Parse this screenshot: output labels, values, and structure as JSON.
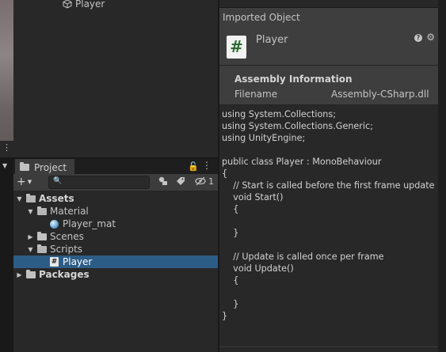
{
  "hierarchy": {
    "items": [
      {
        "label": "Player",
        "icon": "cube-icon"
      }
    ]
  },
  "project": {
    "tab_label": "Project",
    "toolbar": {
      "search_value": "",
      "hidden_count": "1"
    },
    "tree": {
      "assets": "Assets",
      "material": "Material",
      "player_mat": "Player_mat",
      "scenes": "Scenes",
      "scripts": "Scripts",
      "player_script": "Player",
      "packages": "Packages"
    },
    "selected_item": "Player"
  },
  "inspector": {
    "header": "Imported Object",
    "asset_name": "Player",
    "section_title": "Assembly Information",
    "filename_label": "Filename",
    "filename_value": "Assembly-CSharp.dll",
    "code": "using System.Collections;\nusing System.Collections.Generic;\nusing UnityEngine;\n\npublic class Player : MonoBehaviour\n{\n    // Start is called before the first frame update\n    void Start()\n    {\n\n    }\n\n    // Update is called once per frame\n    void Update()\n    {\n\n    }\n}"
  },
  "colors": {
    "selection": "#2c5d87",
    "panel": "#282828",
    "header": "#3e3e3e",
    "script_icon_hash": "#2e6b33"
  }
}
